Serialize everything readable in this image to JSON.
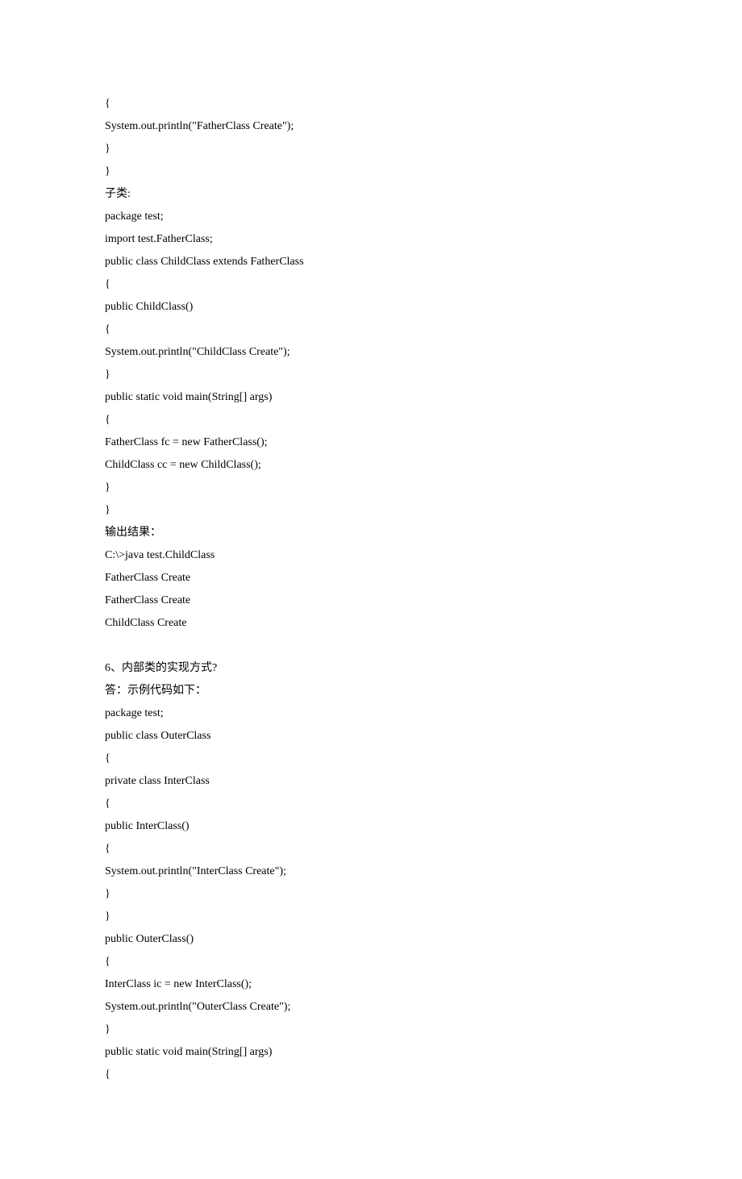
{
  "lines": [
    "{",
    "System.out.println(\"FatherClass Create\");",
    "}",
    "}",
    "子类:",
    "package test;",
    "import test.FatherClass;",
    "public class ChildClass extends FatherClass",
    "{",
    "public ChildClass()",
    "{",
    "System.out.println(\"ChildClass Create\");",
    "}",
    "public static void main(String[] args)",
    "{",
    "FatherClass fc = new FatherClass();",
    "ChildClass cc = new ChildClass();",
    "}",
    "}",
    "输出结果：",
    "C:\\>java test.ChildClass",
    "FatherClass Create",
    "FatherClass Create",
    "ChildClass Create",
    "",
    "6、内部类的实现方式?",
    "答：示例代码如下：",
    "package test;",
    "public class OuterClass",
    "{",
    "private class InterClass",
    "{",
    "public InterClass()",
    "{",
    "System.out.println(\"InterClass Create\");",
    "}",
    "}",
    "public OuterClass()",
    "{",
    "InterClass ic = new InterClass();",
    "System.out.println(\"OuterClass Create\");",
    "}",
    "public static void main(String[] args)",
    "{"
  ]
}
